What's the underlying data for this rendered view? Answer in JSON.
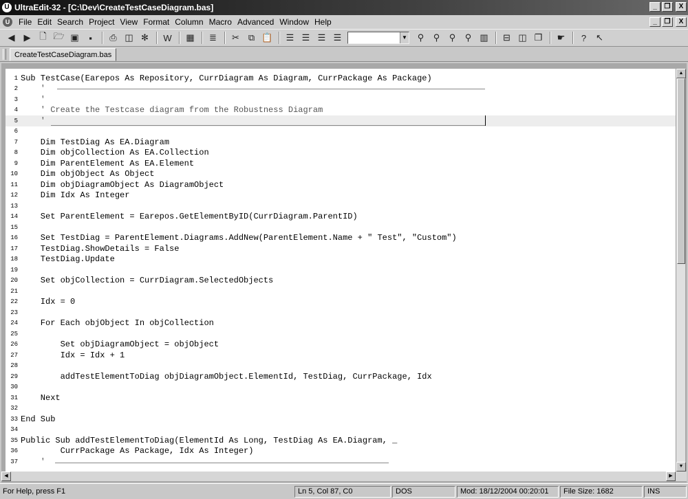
{
  "window": {
    "title": "UltraEdit-32 - [C:\\Dev\\CreateTestCaseDiagram.bas]",
    "min": "_",
    "restore": "❐",
    "close": "X"
  },
  "menu": [
    "File",
    "Edit",
    "Search",
    "Project",
    "View",
    "Format",
    "Column",
    "Macro",
    "Advanced",
    "Window",
    "Help"
  ],
  "toolbar": {
    "icons": [
      "back-arrow",
      "forward-arrow",
      "new-file",
      "open-folder",
      "close-file",
      "save",
      "print",
      "print-preview",
      "spell-check",
      "word-wrap",
      "hex-mode",
      "line-numbers",
      "cut",
      "copy",
      "paste",
      "align-left",
      "align-center",
      "align-right",
      "justify",
      "find-combo",
      "find",
      "find-next",
      "replace",
      "find-in-files",
      "column-mode",
      "window-split",
      "tile",
      "cascade",
      "hand-tool",
      "help",
      "context-help"
    ],
    "combo_value": ""
  },
  "tabs": [
    {
      "label": "CreateTestCaseDiagram.bas"
    }
  ],
  "editor": {
    "current_line": 5,
    "lines": [
      {
        "n": "1",
        "text": "Sub TestCase(Earepos As Repository, CurrDiagram As Diagram, CurrPackage As Package)"
      },
      {
        "n": "2",
        "text": "    '",
        "rule": true
      },
      {
        "n": "3",
        "text": "    '"
      },
      {
        "n": "4",
        "text": "    ' Create the Testcase diagram from the Robustness Diagram"
      },
      {
        "n": "5",
        "text": "    '",
        "caret": true
      },
      {
        "n": "6",
        "text": ""
      },
      {
        "n": "7",
        "text": "    Dim TestDiag As EA.Diagram"
      },
      {
        "n": "8",
        "text": "    Dim objCollection As EA.Collection"
      },
      {
        "n": "9",
        "text": "    Dim ParentElement As EA.Element"
      },
      {
        "n": "10",
        "text": "    Dim objObject As Object"
      },
      {
        "n": "11",
        "text": "    Dim objDiagramObject As DiagramObject"
      },
      {
        "n": "12",
        "text": "    Dim Idx As Integer"
      },
      {
        "n": "13",
        "text": ""
      },
      {
        "n": "14",
        "text": "    Set ParentElement = Earepos.GetElementByID(CurrDiagram.ParentID)"
      },
      {
        "n": "15",
        "text": ""
      },
      {
        "n": "16",
        "text": "    Set TestDiag = ParentElement.Diagrams.AddNew(ParentElement.Name + \" Test\", \"Custom\")"
      },
      {
        "n": "17",
        "text": "    TestDiag.ShowDetails = False"
      },
      {
        "n": "18",
        "text": "    TestDiag.Update"
      },
      {
        "n": "19",
        "text": ""
      },
      {
        "n": "20",
        "text": "    Set objCollection = CurrDiagram.SelectedObjects"
      },
      {
        "n": "21",
        "text": ""
      },
      {
        "n": "22",
        "text": "    Idx = 0"
      },
      {
        "n": "23",
        "text": ""
      },
      {
        "n": "24",
        "text": "    For Each objObject In objCollection"
      },
      {
        "n": "25",
        "text": ""
      },
      {
        "n": "26",
        "text": "        Set objDiagramObject = objObject"
      },
      {
        "n": "27",
        "text": "        Idx = Idx + 1"
      },
      {
        "n": "28",
        "text": ""
      },
      {
        "n": "29",
        "text": "        addTestElementToDiag objDiagramObject.ElementId, TestDiag, CurrPackage, Idx"
      },
      {
        "n": "30",
        "text": ""
      },
      {
        "n": "31",
        "text": "    Next"
      },
      {
        "n": "32",
        "text": ""
      },
      {
        "n": "33",
        "text": "End Sub"
      },
      {
        "n": "34",
        "text": ""
      },
      {
        "n": "35",
        "text": "Public Sub addTestElementToDiag(ElementId As Long, TestDiag As EA.Diagram, _"
      },
      {
        "n": "36",
        "text": "        CurrPackage As Package, Idx As Integer)"
      },
      {
        "n": "37",
        "text": "    '",
        "rule_short": true
      }
    ]
  },
  "status": {
    "help": "For Help, press F1",
    "position": "Ln 5, Col 87, C0",
    "format": "DOS",
    "modified": "Mod: 18/12/2004 00:20:01",
    "filesize": "File Size: 1682",
    "mode": "INS"
  }
}
